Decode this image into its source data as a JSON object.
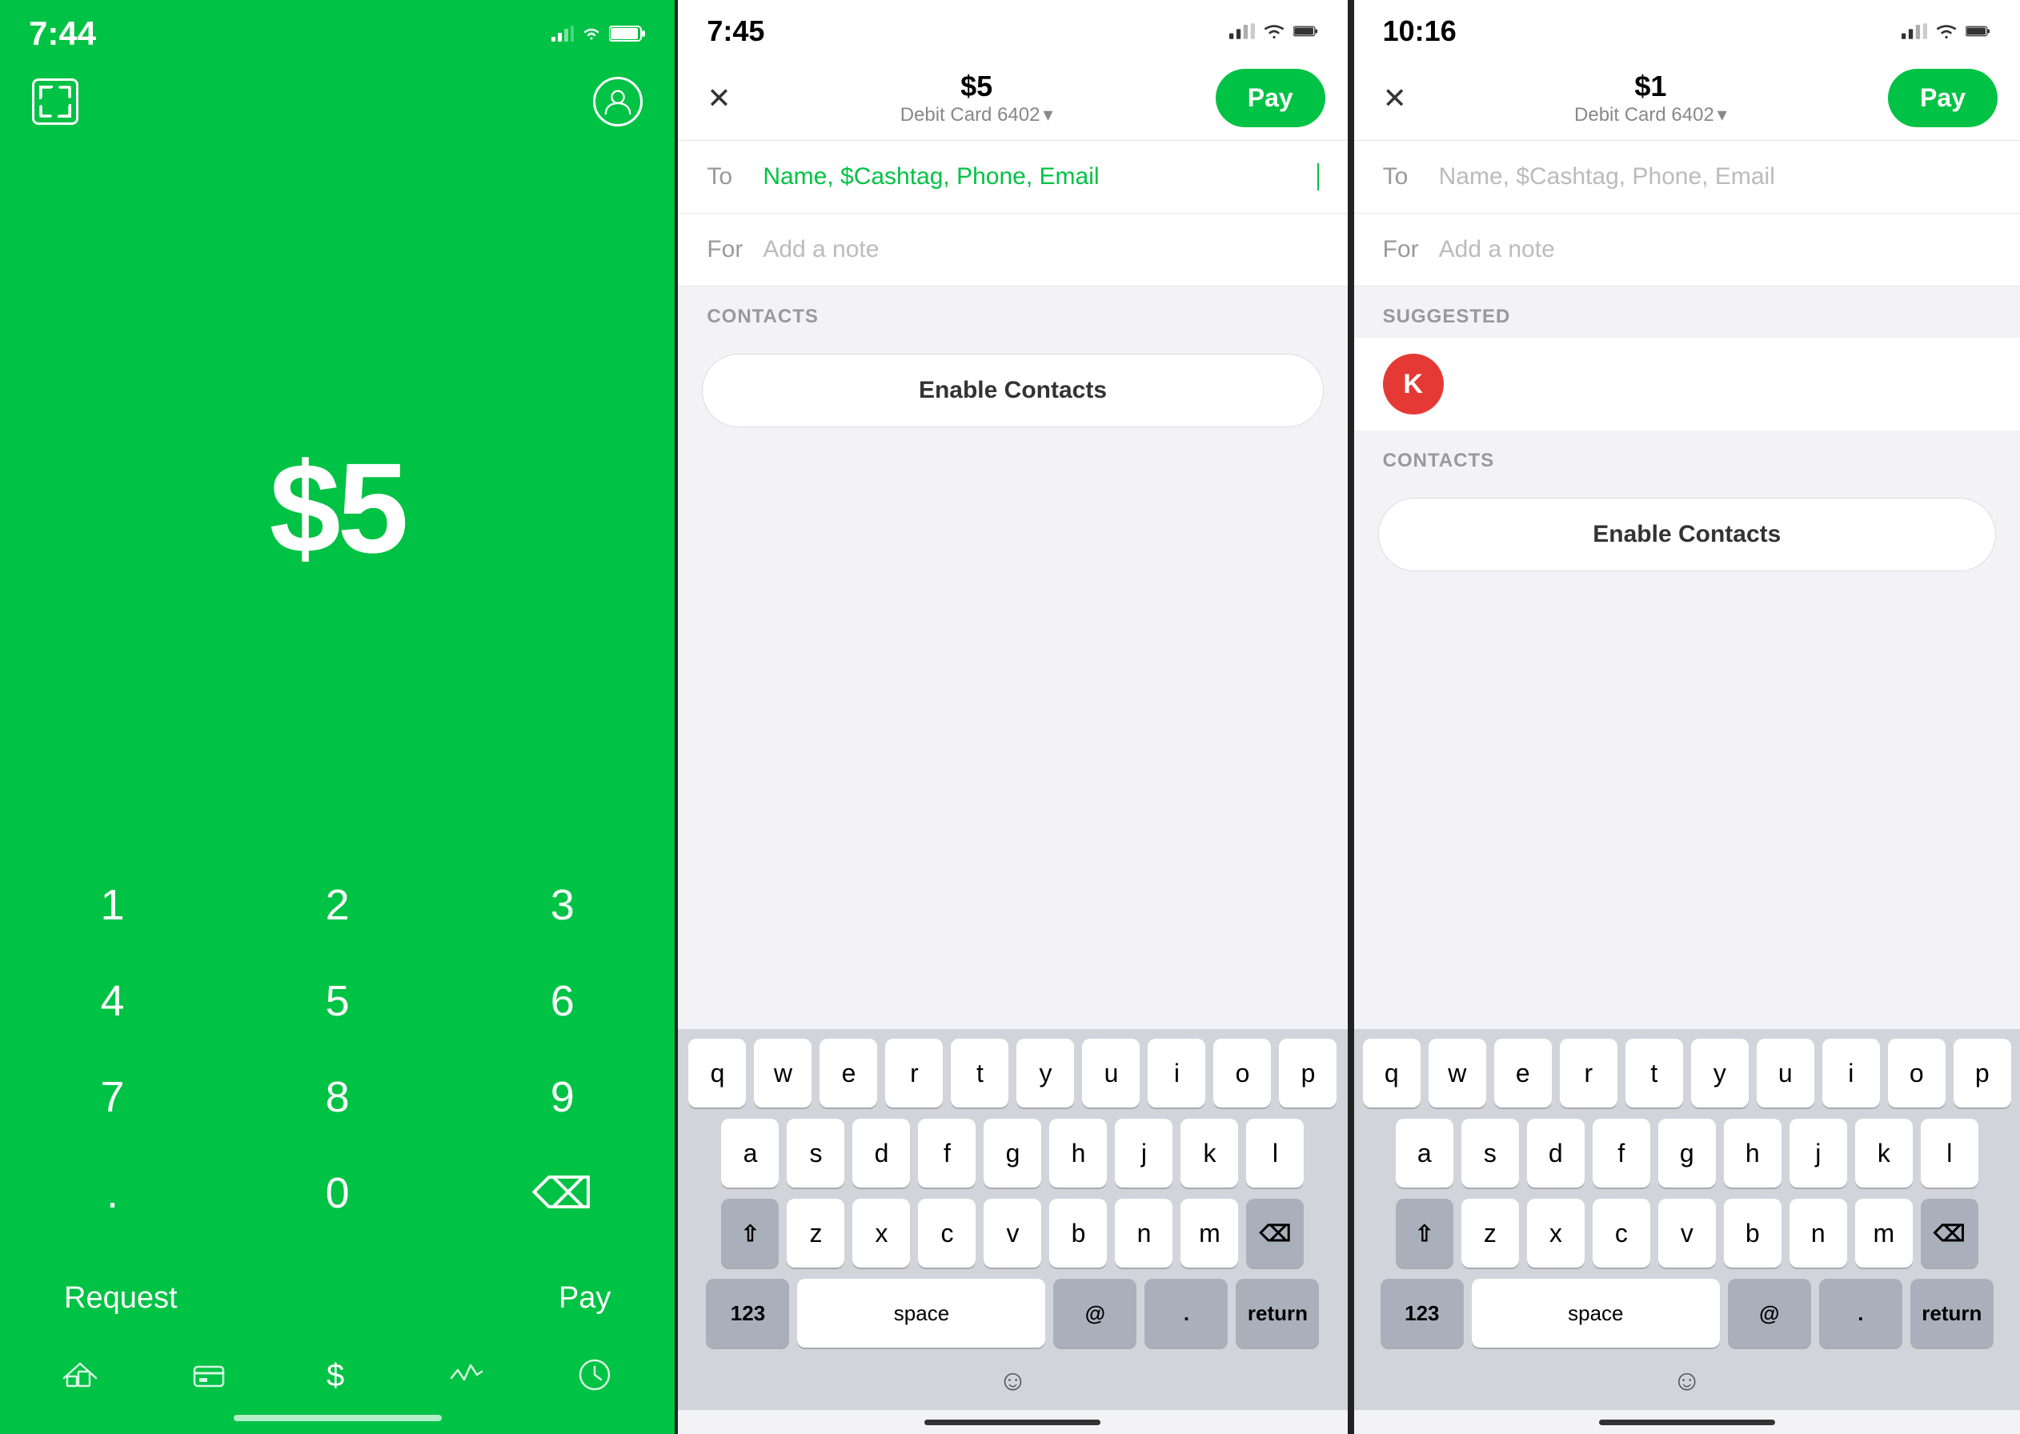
{
  "screen1": {
    "status_time": "7:44",
    "amount": "$5",
    "numpad": [
      "1",
      "2",
      "3",
      "4",
      "5",
      "6",
      "7",
      "8",
      "9",
      ".",
      "0",
      "⌫"
    ],
    "request_label": "Request",
    "pay_label": "Pay",
    "nav_items": [
      "home",
      "card",
      "dollar",
      "activity",
      "clock"
    ]
  },
  "screen2": {
    "status_time": "7:45",
    "amount": "$5",
    "card_info": "Debit Card 6402",
    "pay_button": "Pay",
    "to_label": "To",
    "to_placeholder": "Name, $Cashtag, Phone, Email",
    "for_label": "For",
    "for_placeholder": "Add a note",
    "contacts_header": "CONTACTS",
    "enable_contacts": "Enable Contacts"
  },
  "screen3": {
    "status_time": "10:16",
    "amount": "$1",
    "card_info": "Debit Card 6402",
    "pay_button": "Pay",
    "to_label": "To",
    "to_placeholder": "Name, $Cashtag, Phone, Email",
    "for_label": "For",
    "for_placeholder": "Add a note",
    "suggested_header": "SUGGESTED",
    "suggested_contact_initial": "K",
    "contacts_header": "CONTACTS",
    "enable_contacts": "Enable Contacts"
  },
  "keyboard": {
    "row1": [
      "q",
      "w",
      "e",
      "r",
      "t",
      "y",
      "u",
      "i",
      "o",
      "p"
    ],
    "row2": [
      "a",
      "s",
      "d",
      "f",
      "g",
      "h",
      "j",
      "k",
      "l"
    ],
    "row3": [
      "z",
      "x",
      "c",
      "v",
      "b",
      "n",
      "m"
    ],
    "bottom": [
      "123",
      "space",
      "@",
      ".",
      "return"
    ],
    "shift": "⇧",
    "backspace": "⌫"
  }
}
